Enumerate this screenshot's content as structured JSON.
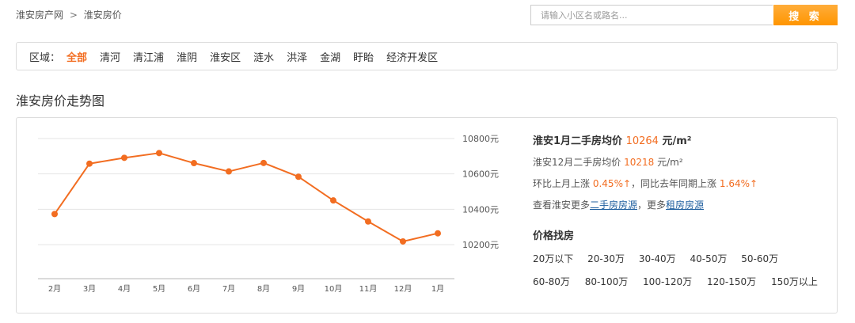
{
  "breadcrumb": {
    "home": "淮安房产网",
    "separator": ">",
    "current": "淮安房价"
  },
  "search": {
    "placeholder": "请输入小区名或路名...",
    "button_label": "搜 索"
  },
  "region_filter": {
    "label": "区域：",
    "items": [
      "全部",
      "清河",
      "清江浦",
      "淮阴",
      "淮安区",
      "涟水",
      "洪泽",
      "金湖",
      "盱眙",
      "经济开发区"
    ],
    "active": "全部"
  },
  "section_title": "淮安房价走势图",
  "info": {
    "headline_prefix": "淮安1月二手房均价",
    "headline_value": "10264",
    "headline_unit": "元/m²",
    "prev_prefix": "淮安12月二手房均价",
    "prev_value": "10218",
    "prev_unit": "元/m²",
    "mom_prefix": "环比上月上涨",
    "mom_value": "0.45%",
    "arrow": "↑",
    "yoy_prefix": "，同比去年同期上涨",
    "yoy_value": "1.64%",
    "more_prefix": "查看淮安更多",
    "more_link_1": "二手房房源",
    "more_mid": "，更多",
    "more_link_2": "租房房源"
  },
  "price_search": {
    "title": "价格找房",
    "row1": [
      "20万以下",
      "20-30万",
      "30-40万",
      "40-50万",
      "50-60万"
    ],
    "row2": [
      "60-80万",
      "80-100万",
      "100-120万",
      "120-150万",
      "150万以上"
    ]
  },
  "colors": {
    "accent": "#f26d21",
    "search_button": "#ff9c1a",
    "link": "#1f5f9f"
  },
  "chart_data": {
    "type": "line",
    "categories": [
      "2月",
      "3月",
      "4月",
      "5月",
      "6月",
      "7月",
      "8月",
      "9月",
      "10月",
      "11月",
      "12月",
      "1月"
    ],
    "values": [
      10373,
      10658,
      10691,
      10718,
      10661,
      10614,
      10662,
      10584,
      10450,
      10331,
      10218,
      10264
    ],
    "ylim": [
      10200,
      10800
    ],
    "yticks": [
      10200,
      10400,
      10600,
      10800
    ],
    "ytick_labels": [
      "10200元",
      "10400元",
      "10600元",
      "10800元"
    ],
    "y_axis_side": "right",
    "grid": true,
    "color": "#f26d21"
  }
}
